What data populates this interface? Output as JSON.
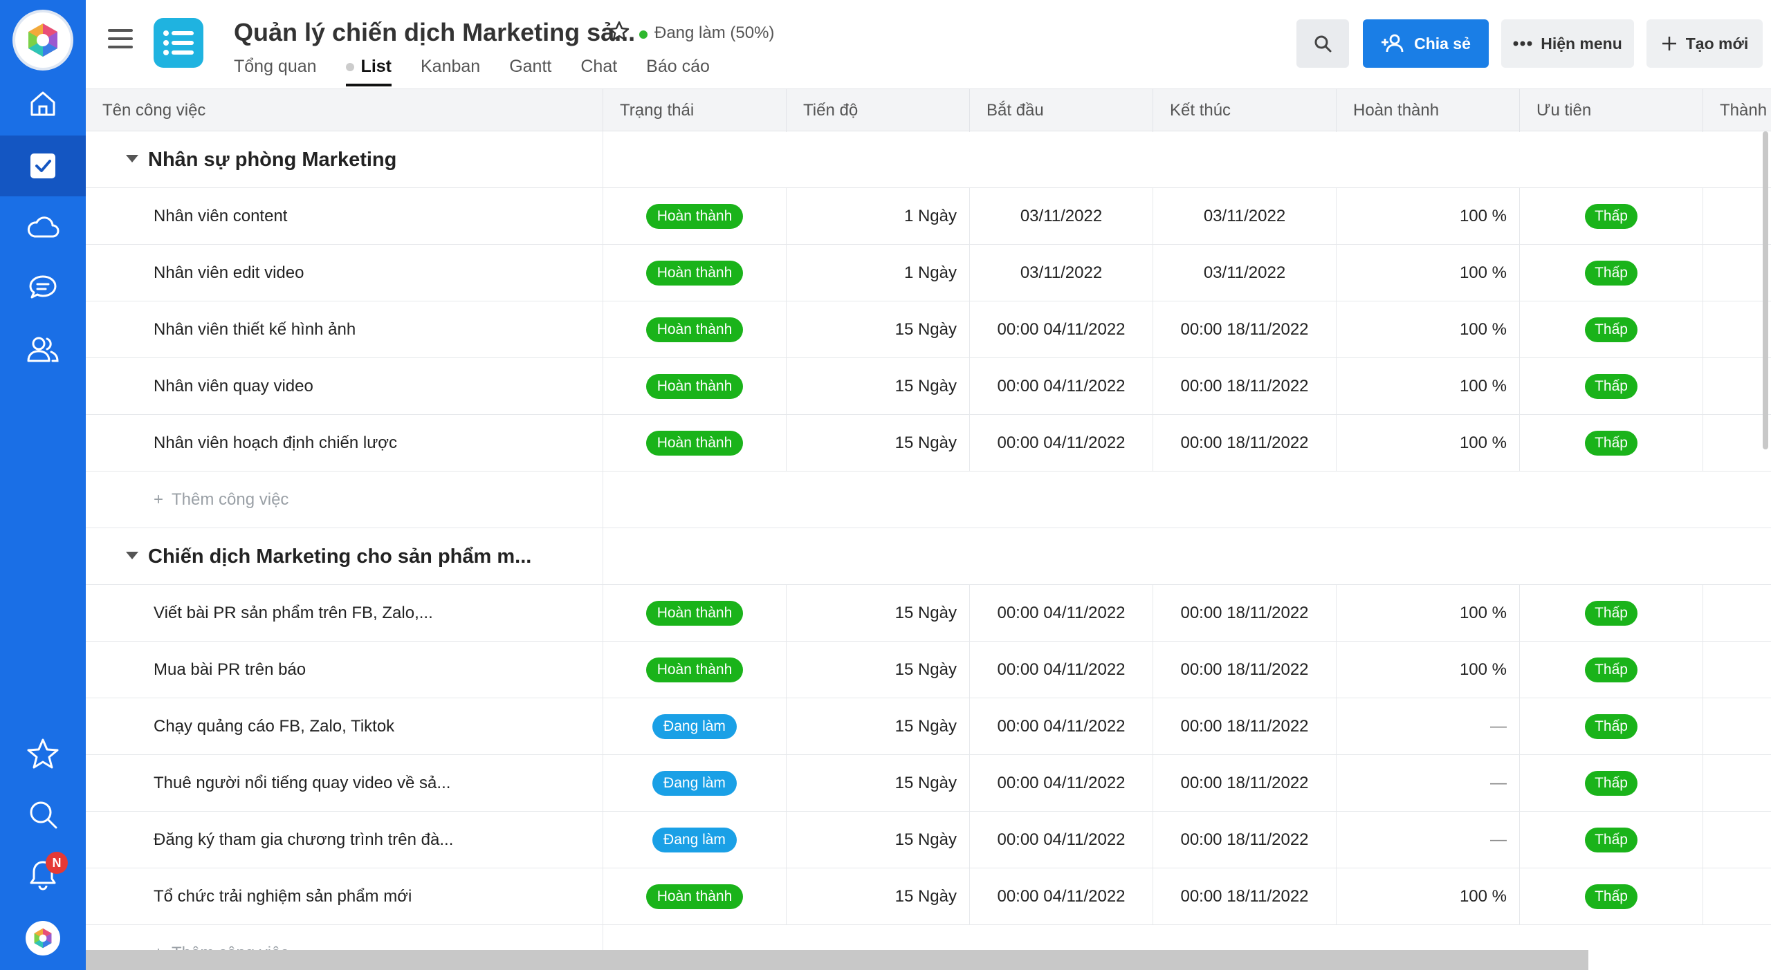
{
  "sidebar": {
    "items": [
      {
        "icon": "home-icon"
      },
      {
        "icon": "task-check-icon",
        "active": true
      },
      {
        "icon": "cloud-icon"
      },
      {
        "icon": "chat-icon"
      },
      {
        "icon": "people-icon"
      }
    ],
    "bottom": [
      {
        "icon": "star-icon"
      },
      {
        "icon": "search-icon"
      },
      {
        "icon": "bell-icon",
        "badge": "N"
      }
    ],
    "colors": {
      "background": "#1a6fe6",
      "active": "#1456c2",
      "badge": "#e53935"
    }
  },
  "header": {
    "title": "Quản lý chiến dịch Marketing sả...",
    "status": "Đang làm (50%)",
    "tabs": [
      {
        "label": "Tổng quan"
      },
      {
        "label": "List",
        "active": true
      },
      {
        "label": "Kanban"
      },
      {
        "label": "Gantt"
      },
      {
        "label": "Chat"
      },
      {
        "label": "Báo cáo"
      }
    ],
    "share_label": "Chia sẻ",
    "menu_label": "Hiện menu",
    "create_label": "Tạo mới",
    "colors": {
      "primary": "#1a7ee6",
      "status_dot": "#2eb82e"
    }
  },
  "table": {
    "columns": [
      "Tên công việc",
      "Trạng thái",
      "Tiến độ",
      "Bắt đầu",
      "Kết thúc",
      "Hoàn thành",
      "Ưu tiên",
      "Thành vi"
    ],
    "add_task_label": "Thêm công việc",
    "groups": [
      {
        "title": "Nhân sự phòng Marketing",
        "tasks": [
          {
            "name": "Nhân viên content",
            "status": "Hoàn thành",
            "status_type": "done",
            "duration": "1 Ngày",
            "start": "03/11/2022",
            "end": "03/11/2022",
            "complete": "100 %",
            "priority": "Thấp"
          },
          {
            "name": "Nhân viên edit video",
            "status": "Hoàn thành",
            "status_type": "done",
            "duration": "1 Ngày",
            "start": "03/11/2022",
            "end": "03/11/2022",
            "complete": "100 %",
            "priority": "Thấp"
          },
          {
            "name": "Nhân viên thiết kế hình ảnh",
            "status": "Hoàn thành",
            "status_type": "done",
            "duration": "15 Ngày",
            "start": "00:00 04/11/2022",
            "end": "00:00 18/11/2022",
            "complete": "100 %",
            "priority": "Thấp"
          },
          {
            "name": "Nhân viên quay video",
            "status": "Hoàn thành",
            "status_type": "done",
            "duration": "15 Ngày",
            "start": "00:00 04/11/2022",
            "end": "00:00 18/11/2022",
            "complete": "100 %",
            "priority": "Thấp"
          },
          {
            "name": "Nhân viên hoạch định chiến lược",
            "status": "Hoàn thành",
            "status_type": "done",
            "duration": "15 Ngày",
            "start": "00:00 04/11/2022",
            "end": "00:00 18/11/2022",
            "complete": "100 %",
            "priority": "Thấp"
          }
        ]
      },
      {
        "title": "Chiến dịch Marketing cho sản phẩm m...",
        "tasks": [
          {
            "name": "Viết bài PR sản phẩm trên FB, Zalo,...",
            "status": "Hoàn thành",
            "status_type": "done",
            "duration": "15 Ngày",
            "start": "00:00 04/11/2022",
            "end": "00:00 18/11/2022",
            "complete": "100 %",
            "priority": "Thấp"
          },
          {
            "name": "Mua bài PR trên báo",
            "status": "Hoàn thành",
            "status_type": "done",
            "duration": "15 Ngày",
            "start": "00:00 04/11/2022",
            "end": "00:00 18/11/2022",
            "complete": "100 %",
            "priority": "Thấp"
          },
          {
            "name": "Chạy quảng cáo FB, Zalo, Tiktok",
            "status": "Đang làm",
            "status_type": "doing",
            "duration": "15 Ngày",
            "start": "00:00 04/11/2022",
            "end": "00:00 18/11/2022",
            "complete": "—",
            "priority": "Thấp"
          },
          {
            "name": "Thuê người nổi tiếng quay video về sả...",
            "status": "Đang làm",
            "status_type": "doing",
            "duration": "15 Ngày",
            "start": "00:00 04/11/2022",
            "end": "00:00 18/11/2022",
            "complete": "—",
            "priority": "Thấp"
          },
          {
            "name": "Đăng ký tham gia chương trình trên đà...",
            "status": "Đang làm",
            "status_type": "doing",
            "duration": "15 Ngày",
            "start": "00:00 04/11/2022",
            "end": "00:00 18/11/2022",
            "complete": "—",
            "priority": "Thấp"
          },
          {
            "name": "Tổ chức trải nghiệm sản phẩm mới",
            "status": "Hoàn thành",
            "status_type": "done",
            "duration": "15 Ngày",
            "start": "00:00 04/11/2022",
            "end": "00:00 18/11/2022",
            "complete": "100 %",
            "priority": "Thấp"
          }
        ]
      }
    ],
    "colors": {
      "done": "#1ab31a",
      "doing": "#1aa0e6",
      "low": "#1ab31a"
    }
  }
}
